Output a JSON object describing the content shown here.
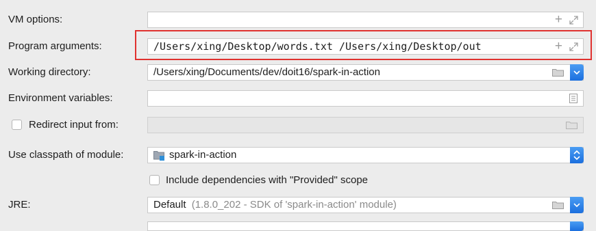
{
  "vm_options": {
    "label": "VM options:",
    "value": ""
  },
  "program_arguments": {
    "label": "Program arguments:",
    "value": "/Users/xing/Desktop/words.txt /Users/xing/Desktop/out"
  },
  "working_directory": {
    "label": "Working directory:",
    "value": "/Users/xing/Documents/dev/doit16/spark-in-action"
  },
  "environment_variables": {
    "label": "Environment variables:",
    "value": ""
  },
  "redirect_input": {
    "label": "Redirect input from:",
    "checked": false,
    "value": ""
  },
  "classpath_module": {
    "label": "Use classpath of module:",
    "value": "spark-in-action"
  },
  "include_provided": {
    "label": "Include dependencies with \"Provided\" scope",
    "checked": false
  },
  "jre": {
    "label": "JRE:",
    "value": "Default",
    "detail": "(1.8.0_202 - SDK of 'spark-in-action' module)"
  },
  "highlight_color": "#e0312f",
  "accent_color": "#1c6fde"
}
